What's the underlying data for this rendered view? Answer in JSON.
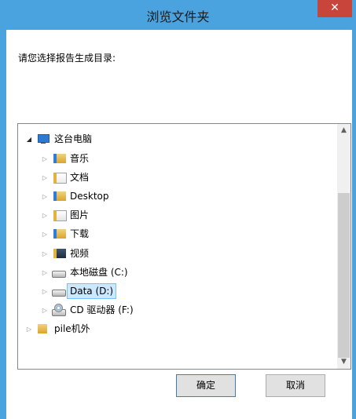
{
  "window": {
    "title": "浏览文件夹",
    "close_glyph": "✕"
  },
  "prompt": "请您选择报告生成目录:",
  "tree": {
    "root": {
      "label": "这台电脑",
      "icon": "computer-icon"
    },
    "children": [
      {
        "label": "音乐",
        "icon": "music-folder-icon"
      },
      {
        "label": "文档",
        "icon": "documents-folder-icon"
      },
      {
        "label": "Desktop",
        "icon": "desktop-folder-icon"
      },
      {
        "label": "图片",
        "icon": "pictures-folder-icon"
      },
      {
        "label": "下载",
        "icon": "downloads-folder-icon"
      },
      {
        "label": "视频",
        "icon": "videos-folder-icon"
      },
      {
        "label": "本地磁盘 (C:)",
        "icon": "drive-icon"
      },
      {
        "label": "Data (D:)",
        "icon": "drive-icon",
        "selected": true
      },
      {
        "label": "CD 驱动器 (F:)",
        "icon": "cd-drive-icon"
      }
    ],
    "sibling": {
      "label": "pile机外",
      "icon": "folder-icon"
    }
  },
  "scrollbar": {
    "up_glyph": "▲",
    "down_glyph": "▼"
  },
  "buttons": {
    "ok": "确定",
    "cancel": "取消"
  },
  "colors": {
    "titlebar": "#4aa3df",
    "close": "#c7453a",
    "selection": "#cce8ff"
  }
}
